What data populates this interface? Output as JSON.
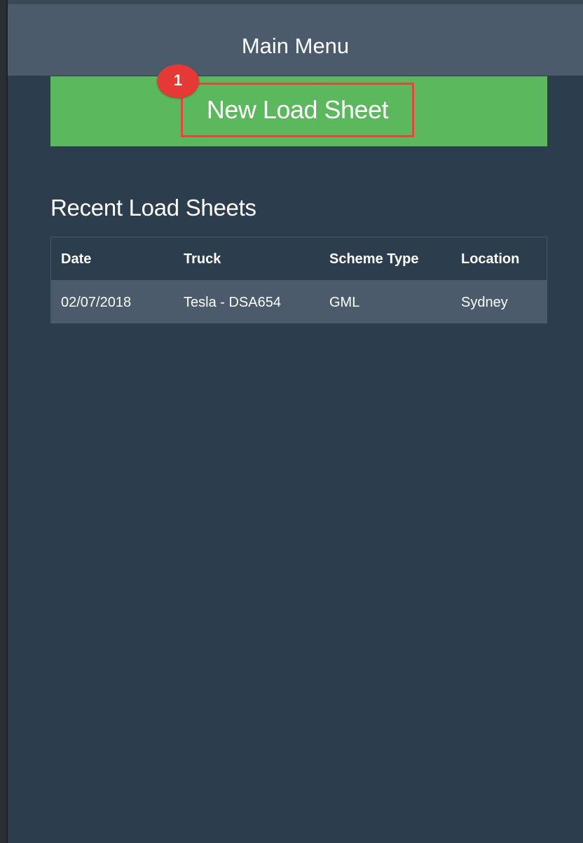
{
  "header": {
    "title": "Main Menu"
  },
  "new_load_sheet": {
    "label": "New Load Sheet",
    "step_number": "1"
  },
  "recent": {
    "title": "Recent Load Sheets",
    "columns": [
      "Date",
      "Truck",
      "Scheme Type",
      "Location"
    ],
    "rows": [
      [
        "02/07/2018",
        "Tesla - DSA654",
        "GML",
        "Sydney"
      ]
    ]
  },
  "colors": {
    "background": "#2c3d4e",
    "header": "#4b5b6b",
    "accent_green": "#5cb85c",
    "highlight_red": "#e1473d",
    "badge_red": "#e53935"
  }
}
